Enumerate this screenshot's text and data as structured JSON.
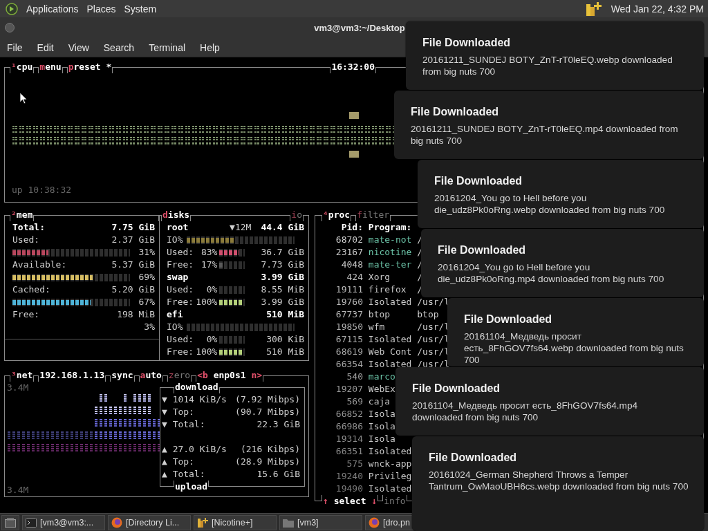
{
  "top_panel": {
    "menus": [
      "Applications",
      "Places",
      "System"
    ],
    "clock": "Wed Jan 22, 4:32 PM"
  },
  "window": {
    "title": "vm3@vm3:~/Desktop",
    "menu": [
      "File",
      "Edit",
      "View",
      "Search",
      "Terminal",
      "Help"
    ]
  },
  "cpu": {
    "title_left": [
      [
        {
          "text": "¹cpu",
          "kind": "hot"
        }
      ],
      [
        {
          "text": "menu",
          "kind": "hot"
        }
      ],
      [
        {
          "text": "preset *",
          "kind": "hot"
        }
      ]
    ],
    "title_right": [
      [
        {
          "text": "16:32:00",
          "kind": "plain"
        }
      ]
    ],
    "uptime": "up 10:38:32"
  },
  "mem": {
    "title": [
      [
        {
          "text": "²mem",
          "kind": "hot"
        }
      ]
    ],
    "rows": [
      {
        "kind": "row",
        "label": "Total:",
        "value": "7.75 GiB",
        "bold": true
      },
      {
        "kind": "row",
        "label": "Used:",
        "value": "2.37 GiB",
        "bold": false
      },
      {
        "kind": "meter",
        "level": 0.31,
        "percent": "31%",
        "color": "#b8475e"
      },
      {
        "kind": "row",
        "label": "Available:",
        "value": "5.37 GiB",
        "bold": false
      },
      {
        "kind": "meter",
        "level": 0.69,
        "percent": "69%",
        "color": "#d6bd63"
      },
      {
        "kind": "row",
        "label": "Cached:",
        "value": "5.20 GiB",
        "bold": false
      },
      {
        "kind": "meter",
        "level": 0.67,
        "percent": "67%",
        "color": "#4fb4d8"
      },
      {
        "kind": "row",
        "label": "Free:",
        "value": "198 MiB",
        "bold": false
      },
      {
        "kind": "percent",
        "percent": "3%"
      }
    ]
  },
  "disks": {
    "title": [
      [
        {
          "text": "disks",
          "kind": "hot"
        }
      ]
    ],
    "title_right": [
      [
        {
          "text": "io",
          "kind": "hot-dim"
        }
      ]
    ],
    "rows": [
      {
        "kind": "disk",
        "name": "root",
        "io": "▼12M",
        "size": "44.4 GiB"
      },
      {
        "kind": "io",
        "label": "IO%",
        "level": 0.45
      },
      {
        "kind": "usage",
        "label": "Used:",
        "percent": "83%",
        "level": 0.83,
        "color": "#d0506e",
        "value": "36.7 GiB"
      },
      {
        "kind": "usage",
        "label": "Free:",
        "percent": "17%",
        "level": 0.17,
        "color": "#5a5a5a",
        "value": "7.73 GiB"
      },
      {
        "kind": "disk",
        "name": "swap",
        "size": "3.99 GiB"
      },
      {
        "kind": "usage",
        "label": "Used:",
        "percent": "0%",
        "level": 0,
        "value": "8.55 MiB"
      },
      {
        "kind": "usage",
        "label": "Free:",
        "percent": "100%",
        "level": 1,
        "color": "#b4d07a",
        "value": "3.99 GiB"
      },
      {
        "kind": "disk",
        "name": "efi",
        "size": "510 MiB"
      },
      {
        "kind": "io",
        "label": "IO%",
        "level": 0
      },
      {
        "kind": "usage",
        "label": "Used:",
        "percent": "0%",
        "level": 0,
        "value": "300 KiB"
      },
      {
        "kind": "usage",
        "label": "Free:",
        "percent": "100%",
        "level": 1,
        "color": "#b4d07a",
        "value": "510 MiB"
      }
    ]
  },
  "net": {
    "title": [
      [
        {
          "text": "³net",
          "kind": "hot"
        }
      ],
      [
        {
          "text": "192.168.1.13",
          "kind": "plain"
        }
      ],
      [
        {
          "text": "sync",
          "kind": "plain"
        }
      ],
      [
        {
          "text": "auto",
          "kind": "hot"
        }
      ],
      [
        {
          "text": "zero",
          "kind": "hot-dim"
        }
      ],
      [
        {
          "text": "<b",
          "kind": "accent"
        },
        {
          "text": "enp0s1",
          "kind": "plain"
        },
        {
          "text": "n>",
          "kind": "accent"
        }
      ]
    ],
    "scale_top": "3.4M",
    "scale_bottom": "3.4M",
    "download": {
      "title": "download",
      "rows": [
        {
          "arrow": "▼",
          "label": "1014 KiB/s",
          "value": "(7.92 Mibps)"
        },
        {
          "arrow": "▼",
          "label": "Top:",
          "value": "(90.7 Mibps)"
        },
        {
          "arrow": "▼",
          "label": "Total:",
          "value": "22.3 GiB"
        }
      ]
    },
    "upload": {
      "title": "upload",
      "rows": [
        {
          "arrow": "▲",
          "label": "27.0 KiB/s",
          "value": "(216 Kibps)"
        },
        {
          "arrow": "▲",
          "label": "Top:",
          "value": "(28.9 Mibps)"
        },
        {
          "arrow": "▲",
          "label": "Total:",
          "value": "15.6 GiB"
        }
      ]
    }
  },
  "proc": {
    "title": [
      [
        {
          "text": "⁴proc",
          "kind": "hot"
        }
      ],
      [
        {
          "text": "filter",
          "kind": "hot-dim"
        }
      ]
    ],
    "columns": [
      "Pid:",
      "Program:"
    ],
    "rows": [
      {
        "pid": "68702",
        "program": "mate-not",
        "command": "/",
        "color": "#6cc4a8"
      },
      {
        "pid": "23167",
        "program": "nicotine",
        "command": "/",
        "color": "#6cc4a8"
      },
      {
        "pid": "4048",
        "program": "mate-ter",
        "command": "/",
        "color": "#6cc4a8"
      },
      {
        "pid": "424",
        "program": "Xorg",
        "command": "/",
        "color": "#c8c8c8"
      },
      {
        "pid": "19111",
        "program": "firefox",
        "command": "/",
        "color": "#c8c8c8"
      },
      {
        "pid": "19760",
        "program": "Isolated",
        "command": "/usr/l",
        "color": "#c8c8c8"
      },
      {
        "pid": "67737",
        "program": "btop",
        "command": "btop",
        "color": "#c8c8c8"
      },
      {
        "pid": "19850",
        "program": "wfm",
        "command": "/usr/l",
        "color": "#c8c8c8"
      },
      {
        "pid": "67115",
        "program": "Isolated",
        "command": "/usr/l",
        "color": "#c8c8c8"
      },
      {
        "pid": "68619",
        "program": "Web Cont",
        "command": "/usr/l",
        "color": "#c8c8c8"
      },
      {
        "pid": "66354",
        "program": "Isolated",
        "command": "/usr/l",
        "color": "#c8c8c8"
      },
      {
        "pid": "540",
        "program": "marco",
        "color": "#6cc4a8"
      },
      {
        "pid": "19207",
        "program": "WebEx",
        "color": "#c8c8c8"
      },
      {
        "pid": "569",
        "program": "caja",
        "color": "#c8c8c8"
      },
      {
        "pid": "66852",
        "program": "Isola",
        "color": "#c8c8c8"
      },
      {
        "pid": "66986",
        "program": "Isola",
        "color": "#c8c8c8"
      },
      {
        "pid": "19314",
        "program": "Isola",
        "color": "#c8c8c8"
      },
      {
        "pid": "66351",
        "program": "Isolated",
        "color": "#c8c8c8"
      },
      {
        "pid": "575",
        "program": "wnck-app",
        "color": "#c8c8c8"
      },
      {
        "pid": "19240",
        "program": "Privileg",
        "color": "#c8c8c8"
      },
      {
        "pid": "19490",
        "program": "Isolated",
        "color": "#c8c8c8"
      }
    ],
    "footer": [
      [
        {
          "text": "↑",
          "kind": "accent"
        },
        {
          "text": "select",
          "kind": "plain"
        },
        {
          "text": "↓",
          "kind": "accent"
        }
      ],
      [
        {
          "text": "info",
          "kind": "dim"
        }
      ]
    ]
  },
  "notifications": [
    {
      "title": "File Downloaded",
      "body": "20161211_SUNDEJ BOTY_ZnT-rT0leEQ.webp downloaded from big nuts 700"
    },
    {
      "title": "File Downloaded",
      "body": "20161211_SUNDEJ BOTY_ZnT-rT0leEQ.mp4 downloaded from big nuts 700"
    },
    {
      "title": "File Downloaded",
      "body": "20161204_You go to Hell before you die_udz8Pk0oRng.webp downloaded from big nuts 700"
    },
    {
      "title": "File Downloaded",
      "body": "20161204_You go to Hell before you die_udz8Pk0oRng.mp4 downloaded from big nuts 700"
    },
    {
      "title": "File Downloaded",
      "body": "20161104_Медведь просит есть_8FhGOV7fs64.webp downloaded from big nuts 700"
    },
    {
      "title": "File Downloaded",
      "body": "20161104_Медведь просит есть_8FhGOV7fs64.mp4 downloaded from big nuts 700"
    },
    {
      "title": "File Downloaded",
      "body": "20161024_German Shepherd Throws a Temper Tantrum_OwMaoUBH6cs.webp downloaded from big nuts 700"
    }
  ],
  "taskbar": [
    {
      "kind": "desktop"
    },
    {
      "kind": "terminal",
      "label": "[vm3@vm3:..."
    },
    {
      "kind": "browser",
      "label": "[Directory Li..."
    },
    {
      "kind": "plus",
      "label": "[Nicotine+]"
    },
    {
      "kind": "folder",
      "label": "[vm3]"
    },
    {
      "kind": "browser",
      "label": "[dro.pn"
    }
  ]
}
